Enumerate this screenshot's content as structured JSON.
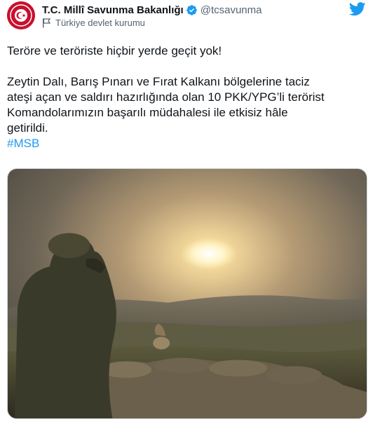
{
  "account": {
    "display_name": "T.C. Millî Savunma Bakanlığı",
    "handle": "@tcsavunma",
    "label": "Türkiye devlet kurumu",
    "verified": true
  },
  "tweet": {
    "line1": "Teröre ve teröriste hiçbir yerde geçit yok!",
    "line2": "Zeytin Dalı, Barış Pınarı ve Fırat Kalkanı bölgelerine taciz",
    "line3": "ateşi açan ve saldırı hazırlığında olan 10 PKK/YPG’li terörist",
    "line4": "Komandolarımızın başarılı müdahalesi ile etkisiz hâle",
    "line5": "getirildi.",
    "hashtag": "#MSB"
  },
  "colors": {
    "link": "#1d9bf0",
    "verified": "#1d9bf0",
    "brand": "#c8102e"
  },
  "icons": {
    "brand": "twitter-bird-icon",
    "verified": "verified-badge-icon",
    "label": "government-flag-icon"
  }
}
